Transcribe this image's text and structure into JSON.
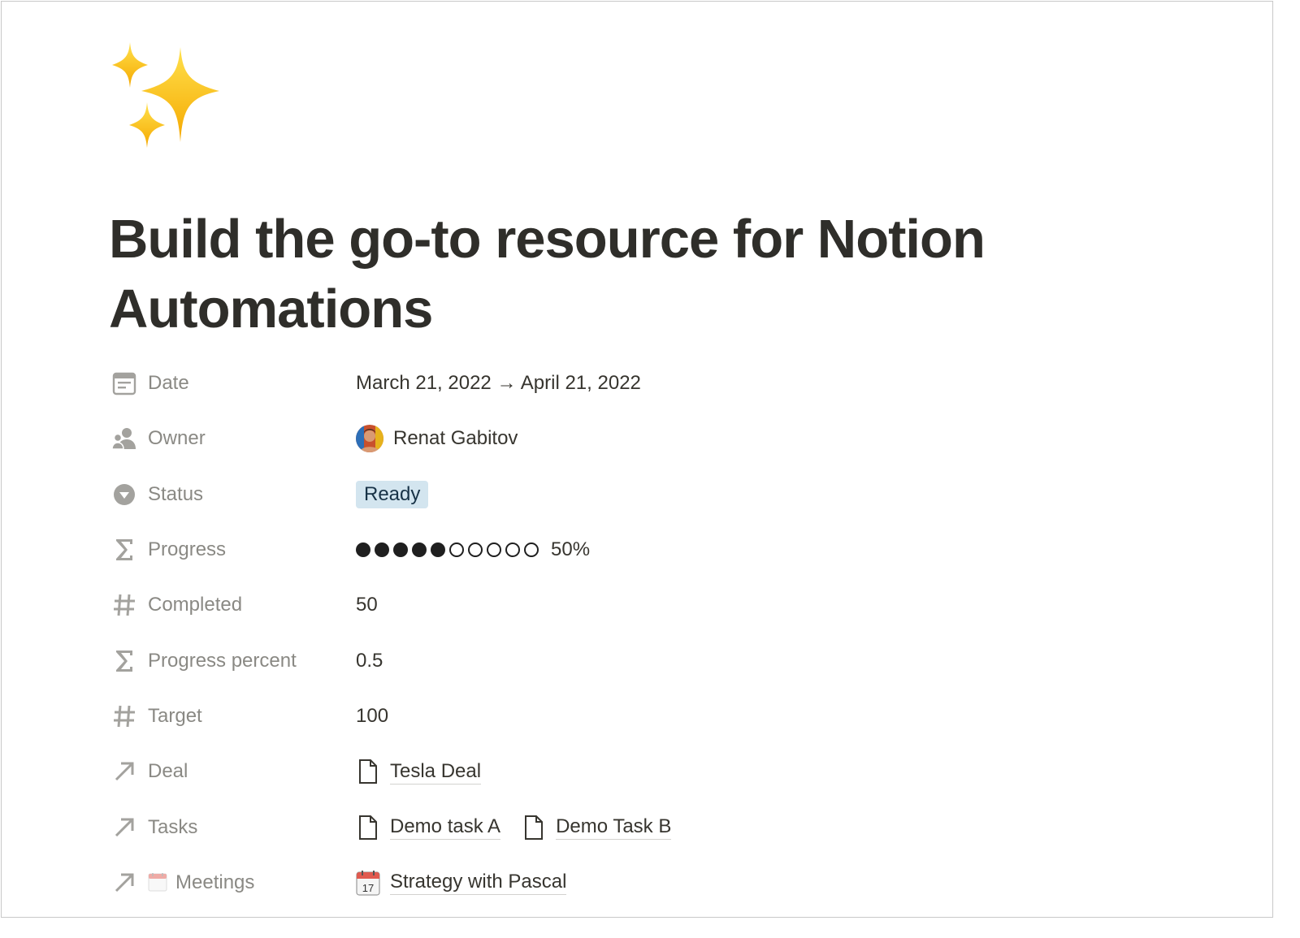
{
  "page": {
    "icon": "sparkles-icon",
    "title": "Build the go-to resource for Notion Automations"
  },
  "properties": {
    "date": {
      "label": "Date",
      "icon": "calendar-icon",
      "value": "March 21, 2022 → April 21, 2022"
    },
    "owner": {
      "label": "Owner",
      "icon": "person-icon",
      "avatar": "avatar",
      "value": "Renat Gabitov"
    },
    "status": {
      "label": "Status",
      "icon": "status-icon",
      "value": "Ready",
      "color": "#d3e5ef"
    },
    "progress": {
      "label": "Progress",
      "icon": "sigma-icon",
      "filled": 5,
      "total": 10,
      "value": "50%"
    },
    "completed": {
      "label": "Completed",
      "icon": "hash-icon",
      "value": "50"
    },
    "progress_percent": {
      "label": "Progress percent",
      "icon": "sigma-icon",
      "value": "0.5"
    },
    "target": {
      "label": "Target",
      "icon": "hash-icon",
      "value": "100"
    },
    "deal": {
      "label": "Deal",
      "icon": "arrow-up-right-icon",
      "items": [
        {
          "icon": "page-icon",
          "text": "Tesla Deal"
        }
      ]
    },
    "tasks": {
      "label": "Tasks",
      "icon": "arrow-up-right-icon",
      "items": [
        {
          "icon": "page-icon",
          "text": "Demo task A"
        },
        {
          "icon": "page-icon",
          "text": "Demo Task B"
        }
      ]
    },
    "meetings": {
      "label": "Meetings",
      "icon": "arrow-up-right-icon",
      "label_emoji": "calendar-emoji-icon",
      "items": [
        {
          "icon": "calendar-emoji-icon",
          "text": "Strategy with Pascal"
        }
      ]
    }
  },
  "colors": {
    "text": "#37352f",
    "label": "#8a8984",
    "status_bg": "#d3e5ef"
  }
}
